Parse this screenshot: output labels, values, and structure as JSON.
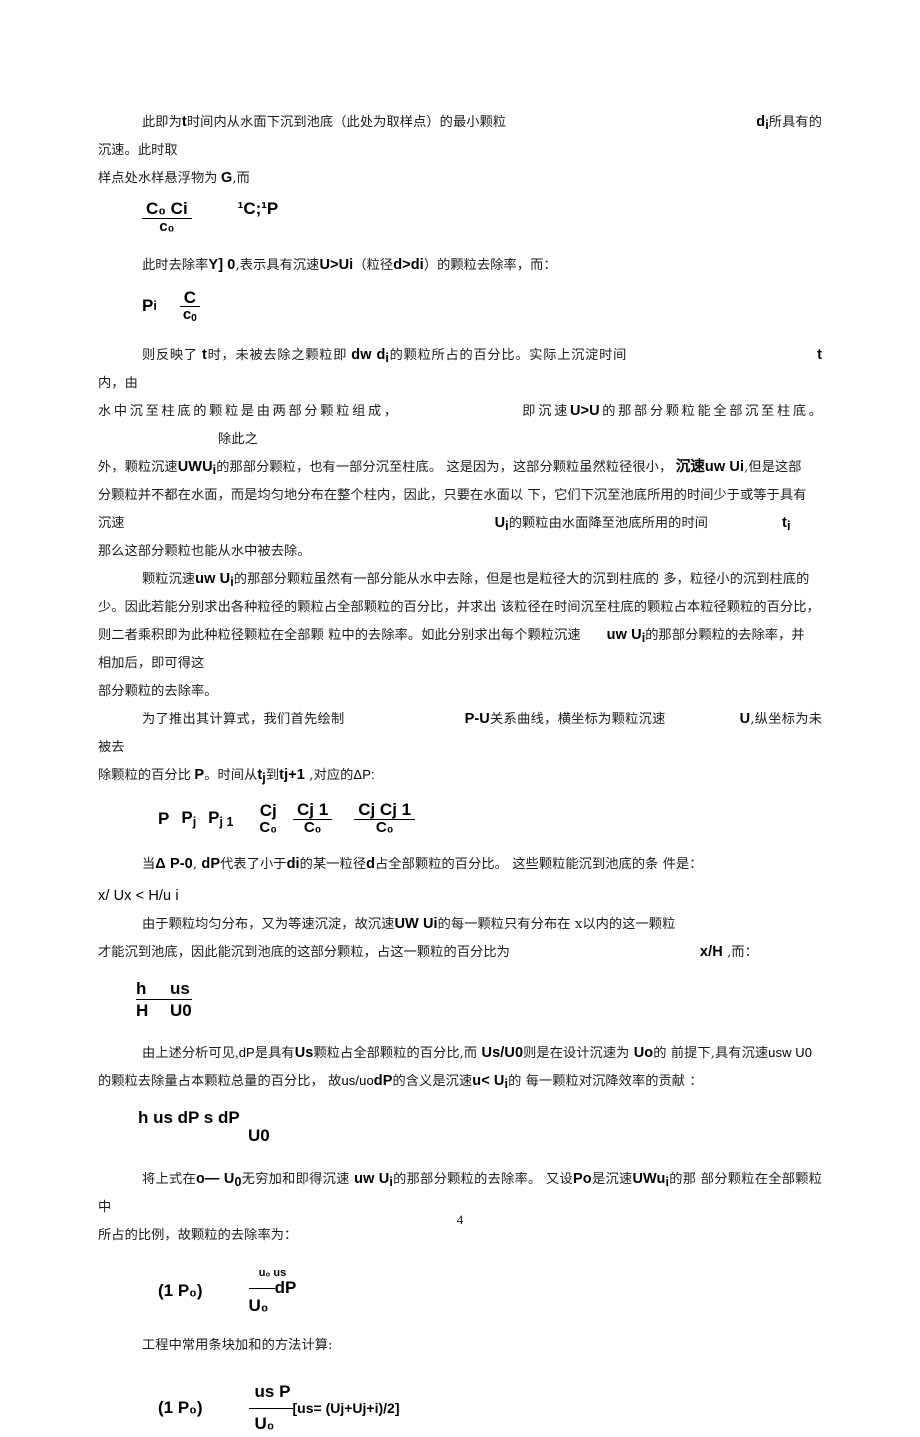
{
  "document": {
    "page_number": "4",
    "language": "zh-CN"
  },
  "paragraphs": {
    "p1_a": "此即为",
    "p1_t": "t",
    "p1_b": "时间内从水面下沉到池底（此处为取样点）的最小颗粒",
    "p1_d": "d",
    "p1_dsub": "i",
    "p1_c": "所具有的沉速。此时取",
    "p2_a": "样点处水样悬浮物为",
    "p2_g": "G",
    "p2_b": ",而",
    "p3_a": "此时去除率",
    "p3_y": "Y] 0",
    "p3_b": ",表示具有沉速",
    "p3_u": "U>Ui",
    "p3_c": "（粒径",
    "p3_d": "d>di",
    "p3_e": "）的颗粒去除率，而：",
    "p4_a": "则反映了",
    "p4_t": "t",
    "p4_b": "时，未被去除之颗粒即",
    "p4_dw": "dw d",
    "p4_dwsub": "i",
    "p4_c": "的颗粒所占的百分比。实际上沉淀时间",
    "p4_t2": "t",
    "p4_d": "内，由",
    "p5_a": "水中沉至柱底的颗粒是由两部分颗粒组成，",
    "p5_b": "即沉速",
    "p5_u": "U>U",
    "p5_c": "的那部分颗粒能全部沉至柱底。",
    "p5_d": "除此之",
    "p6_a": "外，颗粒沉速",
    "p6_u": "UWU",
    "p6_usub": "i",
    "p6_b": "的那部分颗粒，也有一部分沉至柱底。 这是因为，这部分颗粒虽然粒径很小，",
    "p6_u2": "沉速uw Ui",
    "p6_c": ",但是这部",
    "p7": "分颗粒并不都在水面，而是均匀地分布在整个柱内，因此，只要在水面以 下，它们下沉至池底所用的时间少于或等于具有",
    "p8_a": "沉速",
    "p8_u": "U",
    "p8_usub": "i",
    "p8_b": "的颗粒由水面降至池底所用的时间",
    "p8_t": "t",
    "p8_tsub": "i",
    "p9": "那么这部分颗粒也能从水中被去除。",
    "p10_a": "颗粒沉速",
    "p10_u": "uw U",
    "p10_usub": "i",
    "p10_b": "的那部分颗粒虽然有一部分能从水中去除，但是也是粒径大的沉到柱底的 多，粒径小的沉到柱底的",
    "p11": "少。因此若能分别求出各种粒径的颗粒占全部颗粒的百分比，并求出 该粒径在时间沉至柱底的颗粒占本粒径颗粒的百分比，",
    "p12_a": "则二者乘积即为此种粒径颗粒在全部颗 粒中的去除率。如此分别求出每个颗粒沉速",
    "p12_u": "uw U",
    "p12_usub": "i",
    "p12_b": "的那部分颗粒的去除率，并",
    "p13": "相加后，即可得这",
    "p14": "部分颗粒的去除率。",
    "p15_a": "为了推出其计算式，我们首先绘制",
    "p15_pu": "P-U",
    "p15_b": "关系曲线，横坐标为颗粒沉速",
    "p15_u": "U",
    "p15_c": ",纵坐标为未被去",
    "p16_a": "除颗粒的百分比",
    "p16_p": "P",
    "p16_b": "。时间从",
    "p16_tj": "t",
    "p16_tjsub": "j",
    "p16_c": "到",
    "p16_tj1": "tj+1",
    "p16_d": " ,对应的",
    "p16_dp": "ΔP:",
    "p17_a": "当",
    "p17_dp": "Δ P-0",
    "p17_b": ", ",
    "p17_dp2": "dP",
    "p17_c": "代表了小于",
    "p17_di": "di",
    "p17_d": "的某一粒径",
    "p17_dd": "d",
    "p17_e": "占全部颗粒的百分比。 这些颗粒能沉到池底的条 件是：",
    "p18": "x/ Ux < H/u i",
    "p19_a": "由于颗粒均匀分布，又为等速沉淀，故沉速",
    "p19_u": "UW Ui",
    "p19_b": "的每一颗粒只有分布在 x以内的这一颗粒",
    "p20_a": "才能沉到池底，因此能沉到池底的这部分颗粒，占这一颗粒的百分比为",
    "p20_xh": "x/H",
    "p20_b": " ,而：",
    "p21_a": "由上述分析可见",
    "p21_b": ",dP",
    "p21_c": "是具有",
    "p21_us": "Us",
    "p21_d": "颗粒占全部颗粒的百分比",
    "p21_e": ",而 ",
    "p21_usu0": "Us/U0",
    "p21_f": "则是在设计沉速为 ",
    "p21_u0": "Uo",
    "p21_g": "的 前提下",
    "p21_h": ",具有沉速",
    "p21_usw": "usw U0",
    "p22_a": "的颗粒去除量占本颗粒总量的百分比，  故",
    "p22_us": "us/uo",
    "p22_b": "dP",
    "p22_c": "的含义是沉速",
    "p22_u": "u< U",
    "p22_usub": "i",
    "p22_d": "的 每一颗粒对沉降效率的贡献 ：",
    "p23_a": "将上式在",
    "p23_o": "o— U",
    "p23_osub": "0",
    "p23_b": "无穷加和即得沉速 ",
    "p23_u": "uw U",
    "p23_usub": "i",
    "p23_c": "的那部分颗粒的去除率。 又设",
    "p23_p0": "Po",
    "p23_d": "是沉速",
    "p23_uw": "UWu",
    "p23_uwsub": "i",
    "p23_e": "的那 部分颗粒在全部颗粒中",
    "p24": "所占的比例，故颗粒的去除率为：",
    "p25": "工程中常用条块加和的方法计算:"
  },
  "formulas": {
    "f1": {
      "lhs_num": "C₀ Ci",
      "lhs_den": "c₀",
      "rhs": "¹C;¹P"
    },
    "f2": {
      "p_label": "P",
      "p_sub": "i",
      "num": "C",
      "den": "c",
      "den_sub": "0"
    },
    "f3": {
      "t1": "P",
      "t2": "P",
      "t2sub": "j",
      "t3": "P",
      "t3sub": "j 1",
      "frac1_num": "Cj",
      "frac1_den": "C₀",
      "frac2_num": "Cj 1",
      "frac2_den": "C₀",
      "frac3_num": "Cj  Cj 1",
      "frac3_den": "C₀"
    },
    "f4": {
      "num_left": "h",
      "num_right": "us",
      "den_left": "H",
      "den_right": "U0"
    },
    "f5": {
      "lead": "h us dP s dP",
      "den": "U0"
    },
    "f6": {
      "lhs": "(1  P₀)",
      "sup": "u₀ us",
      "bar_tail": "dP",
      "den": "U₀"
    },
    "f7": {
      "lhs": "(1 P₀)",
      "num": "us P",
      "den": "U₀",
      "tail": "[us= (Uj+Uj+i)/2]"
    }
  }
}
